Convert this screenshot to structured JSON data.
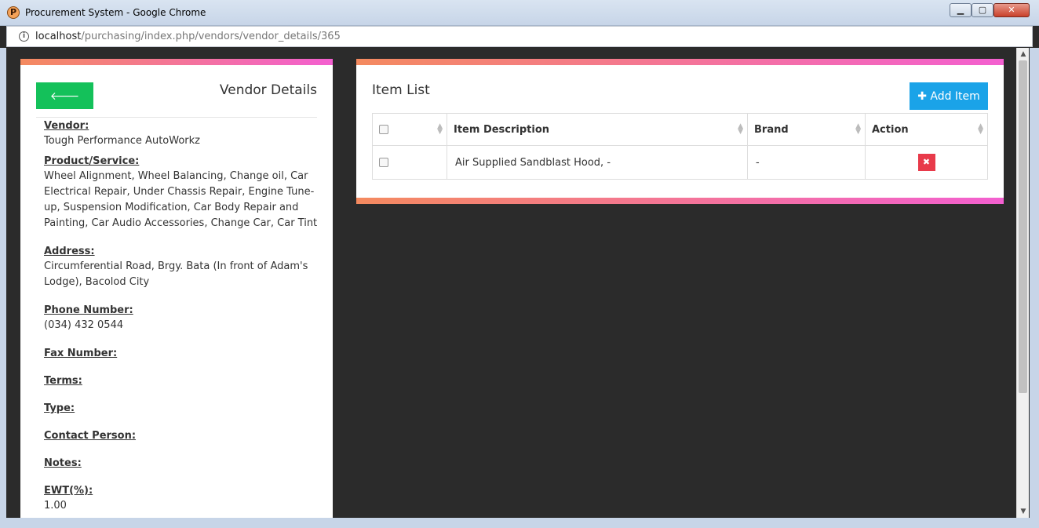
{
  "window": {
    "title": "Procurement System - Google Chrome",
    "app_icon_letter": "P",
    "minimize": "▁",
    "maximize": "▢",
    "close": "✕"
  },
  "browser": {
    "url_host": "localhost",
    "url_path": "/purchasing/index.php/vendors/vendor_details/365"
  },
  "vendor_panel": {
    "back_label": "Back",
    "heading": "Vendor Details",
    "fields": [
      {
        "label": "Vendor:",
        "value": "Tough Performance AutoWorkz"
      },
      {
        "label": "Product/Service:",
        "value": "Wheel Alignment, Wheel Balancing, Change oil, Car Electrical Repair, Under Chassis Repair, Engine Tune-up, Suspension Modification, Car Body Repair and Painting, Car Audio Accessories, Change Car, Car Tint"
      },
      {
        "label": "Address:",
        "value": "Circumferential Road, Brgy. Bata (In front of Adam's Lodge), Bacolod City"
      },
      {
        "label": "Phone Number:",
        "value": "(034) 432 0544"
      },
      {
        "label": "Fax Number:",
        "value": ""
      },
      {
        "label": "Terms:",
        "value": ""
      },
      {
        "label": "Type:",
        "value": ""
      },
      {
        "label": "Contact Person:",
        "value": ""
      },
      {
        "label": "Notes:",
        "value": ""
      },
      {
        "label": "EWT(%):",
        "value": "1.00"
      }
    ]
  },
  "item_panel": {
    "heading": "Item List",
    "add_label": "Add Item",
    "columns": [
      "",
      "Item Description",
      "Brand",
      "Action"
    ],
    "rows": [
      {
        "description": "Air Supplied Sandblast Hood, -",
        "brand": "-"
      }
    ]
  },
  "colors": {
    "gradient_start": "#f48a5f",
    "gradient_end": "#f35fd0",
    "back_button": "#14c15a",
    "add_button": "#1aa3e8",
    "delete_button": "#e83a4a"
  }
}
